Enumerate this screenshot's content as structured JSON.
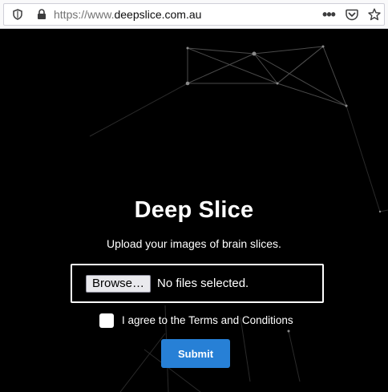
{
  "browser": {
    "url_protocol": "https://www.",
    "url_domain": "deepslice.com.au",
    "menu_glyph": "•••"
  },
  "page": {
    "title": "Deep Slice",
    "subtitle": "Upload your images of brain slices.",
    "file_input": {
      "button_label": "Browse…",
      "status": "No files selected."
    },
    "terms_label": "I agree to the Terms and Conditions",
    "terms_checked": false,
    "submit_label": "Submit"
  },
  "colors": {
    "background": "#000000",
    "accent": "#2780d6",
    "network_line": "#5a5a5a"
  }
}
